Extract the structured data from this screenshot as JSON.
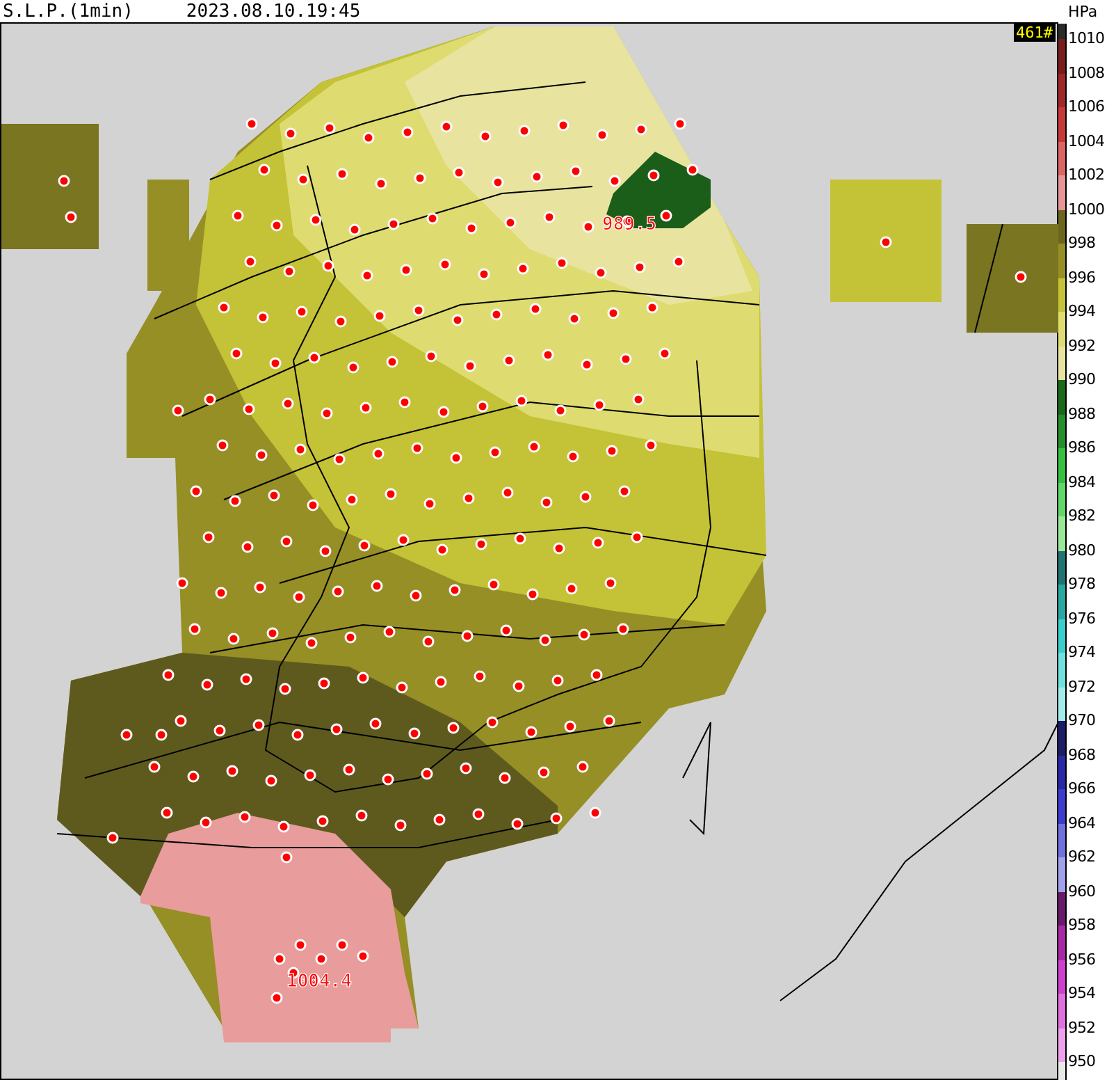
{
  "header": {
    "title": "S.L.P.(1min)",
    "timestamp": "2023.08.10.19:45"
  },
  "station_count": "461#",
  "map": {
    "annotations": [
      {
        "text": "989.5"
      },
      {
        "text": "1004.4"
      }
    ]
  },
  "legend": {
    "unit": "HPa",
    "bands": [
      {
        "label": "1010",
        "color": "#7a1c1c"
      },
      {
        "label": "1008",
        "color": "#a02828"
      },
      {
        "label": "1006",
        "color": "#c83838"
      },
      {
        "label": "1004",
        "color": "#dc6464"
      },
      {
        "label": "1002",
        "color": "#e89494"
      },
      {
        "label": "1000",
        "color": "#6b6520"
      },
      {
        "label": "998",
        "color": "#958f25"
      },
      {
        "label": "996",
        "color": "#c4c236"
      },
      {
        "label": "994",
        "color": "#dedc70"
      },
      {
        "label": "992",
        "color": "#e8e4a0"
      },
      {
        "label": "990",
        "color": "#1a6a1a"
      },
      {
        "label": "988",
        "color": "#24902a"
      },
      {
        "label": "986",
        "color": "#34c040"
      },
      {
        "label": "984",
        "color": "#60d868"
      },
      {
        "label": "982",
        "color": "#98e898"
      },
      {
        "label": "980",
        "color": "#1e7470"
      },
      {
        "label": "978",
        "color": "#28a8a0"
      },
      {
        "label": "976",
        "color": "#38d0cc"
      },
      {
        "label": "974",
        "color": "#70e0dc"
      },
      {
        "label": "972",
        "color": "#a0ece8"
      },
      {
        "label": "970",
        "color": "#1c1c68"
      },
      {
        "label": "968",
        "color": "#2828a8"
      },
      {
        "label": "966",
        "color": "#3c3cd0"
      },
      {
        "label": "964",
        "color": "#7070e0"
      },
      {
        "label": "962",
        "color": "#a0a0ec"
      },
      {
        "label": "960",
        "color": "#6a1a6a"
      },
      {
        "label": "958",
        "color": "#a828a8"
      },
      {
        "label": "956",
        "color": "#d040d0"
      },
      {
        "label": "954",
        "color": "#e070e0"
      },
      {
        "label": "952",
        "color": "#eca0ec"
      },
      {
        "label": "950",
        "color": "#e8e8e8"
      }
    ]
  }
}
